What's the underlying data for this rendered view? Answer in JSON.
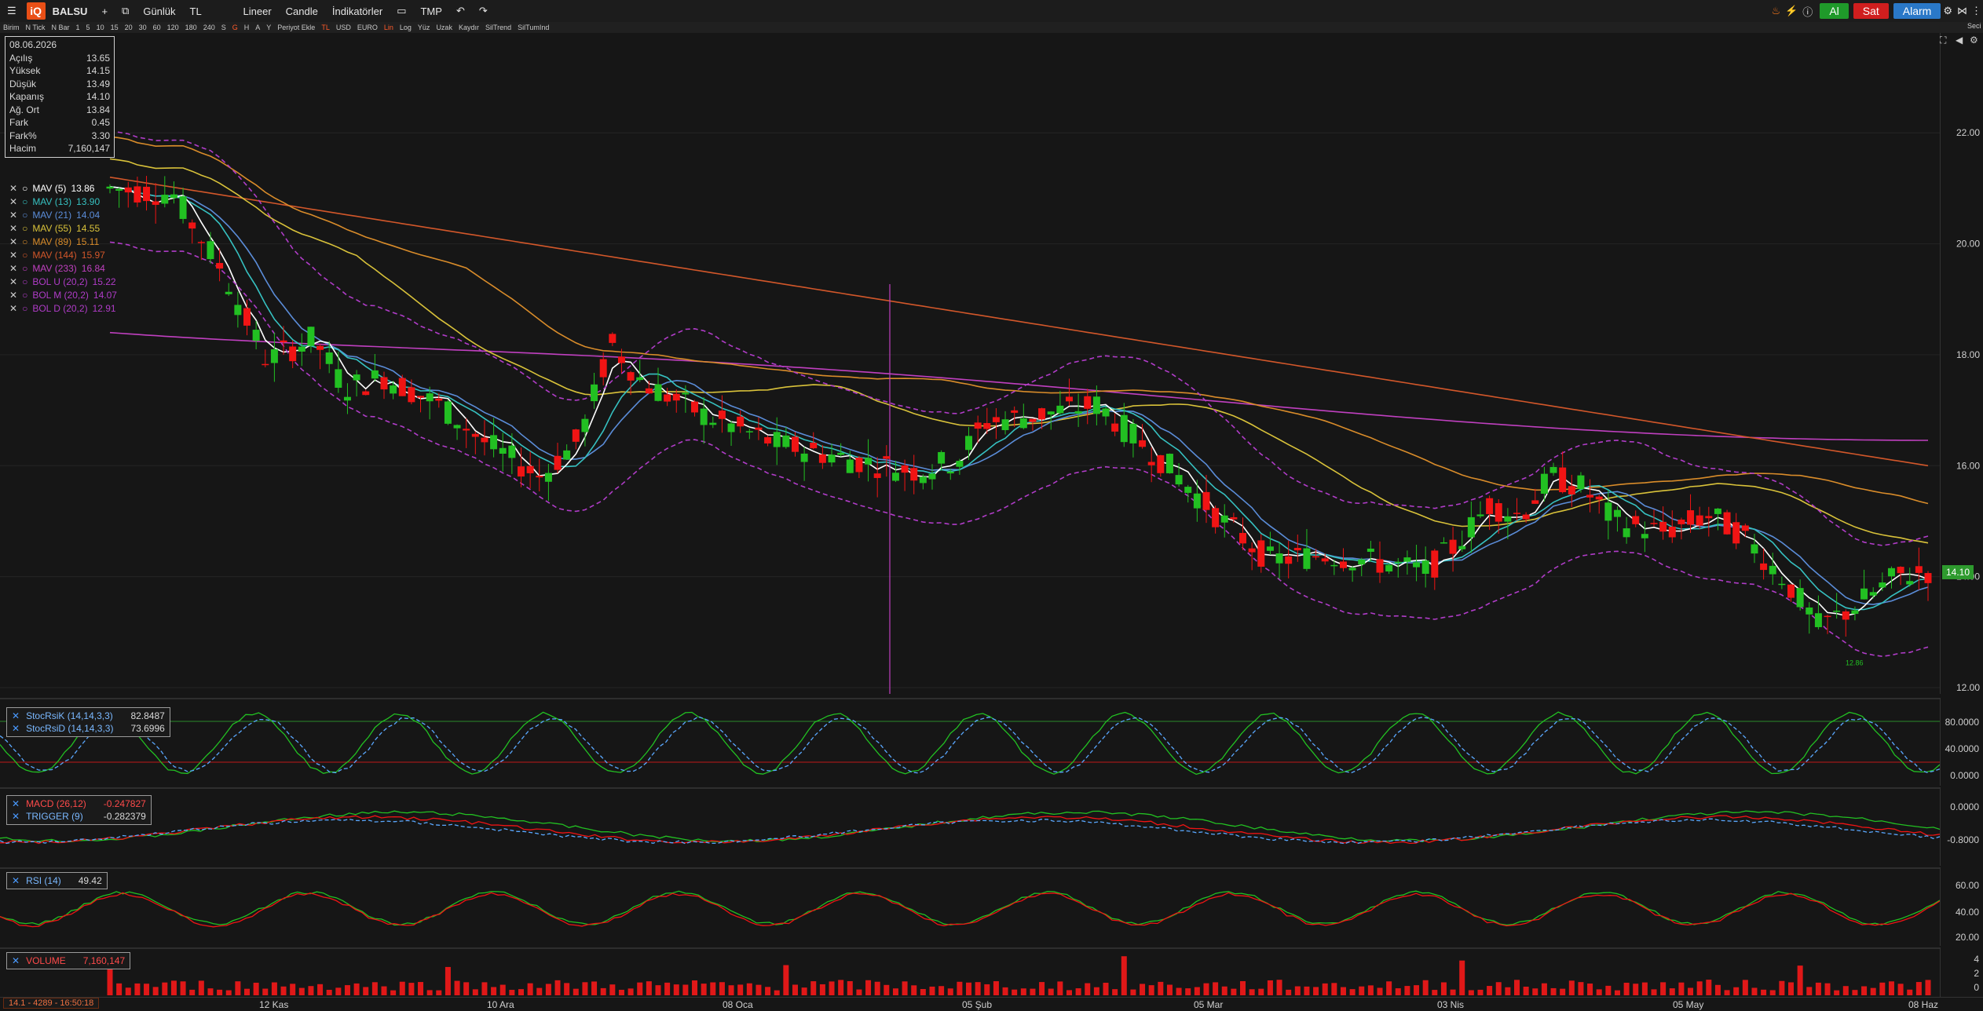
{
  "topbar": {
    "logo": "iQ",
    "symbol": "BALSU",
    "period": "Günlük",
    "currency": "TL",
    "scale": "Lineer",
    "chart_type": "Candle",
    "indicators": "İndikatörler",
    "template": "TMP",
    "buy": "Al",
    "sell": "Sat",
    "alarm": "Alarm",
    "sec": "Seci"
  },
  "toolbar2": [
    "Birim",
    "N Tick",
    "N Bar",
    "1",
    "5",
    "10",
    "15",
    "20",
    "30",
    "60",
    "120",
    "180",
    "240",
    "S",
    "G",
    "H",
    "A",
    "Y",
    "Periyot Ekle",
    "TL",
    "USD",
    "EURO",
    "Lin",
    "Log",
    "Yüz",
    "Uzak",
    "Kaydır",
    "SilTrend",
    "SilTumInd"
  ],
  "toolbar2_active": [
    "G",
    "TL",
    "Lin"
  ],
  "infobox": {
    "date": "08.06.2026",
    "rows": [
      {
        "label": "Açılış",
        "value": "13.65"
      },
      {
        "label": "Yüksek",
        "value": "14.15"
      },
      {
        "label": "Düşük",
        "value": "13.49"
      },
      {
        "label": "Kapanış",
        "value": "14.10"
      },
      {
        "label": "Ağ. Ort",
        "value": "13.84"
      },
      {
        "label": "Fark",
        "value": "0.45"
      },
      {
        "label": "Fark%",
        "value": "3.30"
      },
      {
        "label": "Hacim",
        "value": "7,160,147"
      }
    ]
  },
  "moving_averages": [
    {
      "label": "MAV (5)",
      "value": "13.86",
      "color": "#ffffff"
    },
    {
      "label": "MAV (13)",
      "value": "13.90",
      "color": "#36c1c1"
    },
    {
      "label": "MAV (21)",
      "value": "14.04",
      "color": "#5b8dd9"
    },
    {
      "label": "MAV (55)",
      "value": "14.55",
      "color": "#d9c23a"
    },
    {
      "label": "MAV (89)",
      "value": "15.11",
      "color": "#d98c2a"
    },
    {
      "label": "MAV (144)",
      "value": "15.97",
      "color": "#d2572a"
    },
    {
      "label": "MAV (233)",
      "value": "16.84",
      "color": "#c040c0"
    },
    {
      "label": "BOL U (20,2)",
      "value": "15.22",
      "color": "#b03cc8"
    },
    {
      "label": "BOL M (20,2)",
      "value": "14.07",
      "color": "#b03cc8"
    },
    {
      "label": "BOL D (20,2)",
      "value": "12.91",
      "color": "#b03cc8"
    }
  ],
  "price_axis": [
    "22.00",
    "20.00",
    "18.00",
    "16.00",
    "14.00",
    "12.00"
  ],
  "last_price": "14.10",
  "low_marker": "12.86",
  "stoch": {
    "k_label": "StocRsiK (14,14,3,3)",
    "k_value": "82.8487",
    "d_label": "StocRsiD (14,14,3,3)",
    "d_value": "73.6996",
    "axis": [
      "80.0000",
      "40.0000",
      "0.0000"
    ]
  },
  "macd": {
    "macd_label": "MACD (26,12)",
    "macd_value": "-0.247827",
    "trig_label": "TRIGGER (9)",
    "trig_value": "-0.282379",
    "axis": [
      "0.0000",
      "-0.8000"
    ]
  },
  "rsi": {
    "label": "RSI (14)",
    "value": "49.42",
    "axis": [
      "60.00",
      "40.00",
      "20.00"
    ]
  },
  "volume": {
    "label": "VOLUME",
    "value": "7,160,147",
    "axis": [
      "4",
      "2",
      "0"
    ]
  },
  "x_axis": [
    "12 Kas",
    "10 Ara",
    "08 Oca",
    "05 Şub",
    "05 Mar",
    "03 Nis",
    "05 May",
    "08 Haz"
  ],
  "status": "14.1 - 4289 - 16:50:18",
  "colors": {
    "up": "#22c022",
    "down": "#f01414",
    "accent": "#e94f16",
    "buy": "#1f9a2a",
    "sell": "#d01e1e",
    "alarm": "#2a78c8"
  }
}
